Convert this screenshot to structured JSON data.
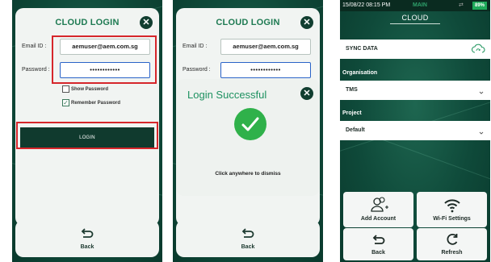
{
  "login_screen": {
    "title": "CLOUD LOGIN",
    "email_label": "Email ID :",
    "email_value": "aemuser@aem.com.sg",
    "password_label": "Password :",
    "password_value": "••••••••••••",
    "show_password_label": "Show Password",
    "remember_password_label": "Remember Password",
    "login_label": "LOGIN",
    "back_label": "Back",
    "close_glyph": "✕"
  },
  "success_screen": {
    "title": "CLOUD LOGIN",
    "email_label": "Email ID :",
    "email_value": "aemuser@aem.com.sg",
    "password_label": "Password :",
    "password_value": "••••••••••••",
    "popup_title": "Login Successful",
    "dismiss_text": "Click anywhere to dismiss",
    "back_label": "Back",
    "close_glyph": "✕"
  },
  "cloud_screen": {
    "status_time": "15/08/22 08:15 PM",
    "status_mode": "MAIN",
    "battery": "89%",
    "title": "CLOUD",
    "sync_label": "SYNC DATA",
    "organisation_label": "Organisation",
    "organisation_value": "TMS",
    "project_label": "Project",
    "project_value": "Default",
    "add_account_label": "Add Account",
    "wifi_label": "Wi-Fi Settings",
    "back_label": "Back",
    "refresh_label": "Refresh"
  },
  "colors": {
    "accent": "#1e7a52",
    "highlight_box": "#d6262b",
    "dark_green": "#103a2e",
    "success_green": "#2fb14a"
  }
}
